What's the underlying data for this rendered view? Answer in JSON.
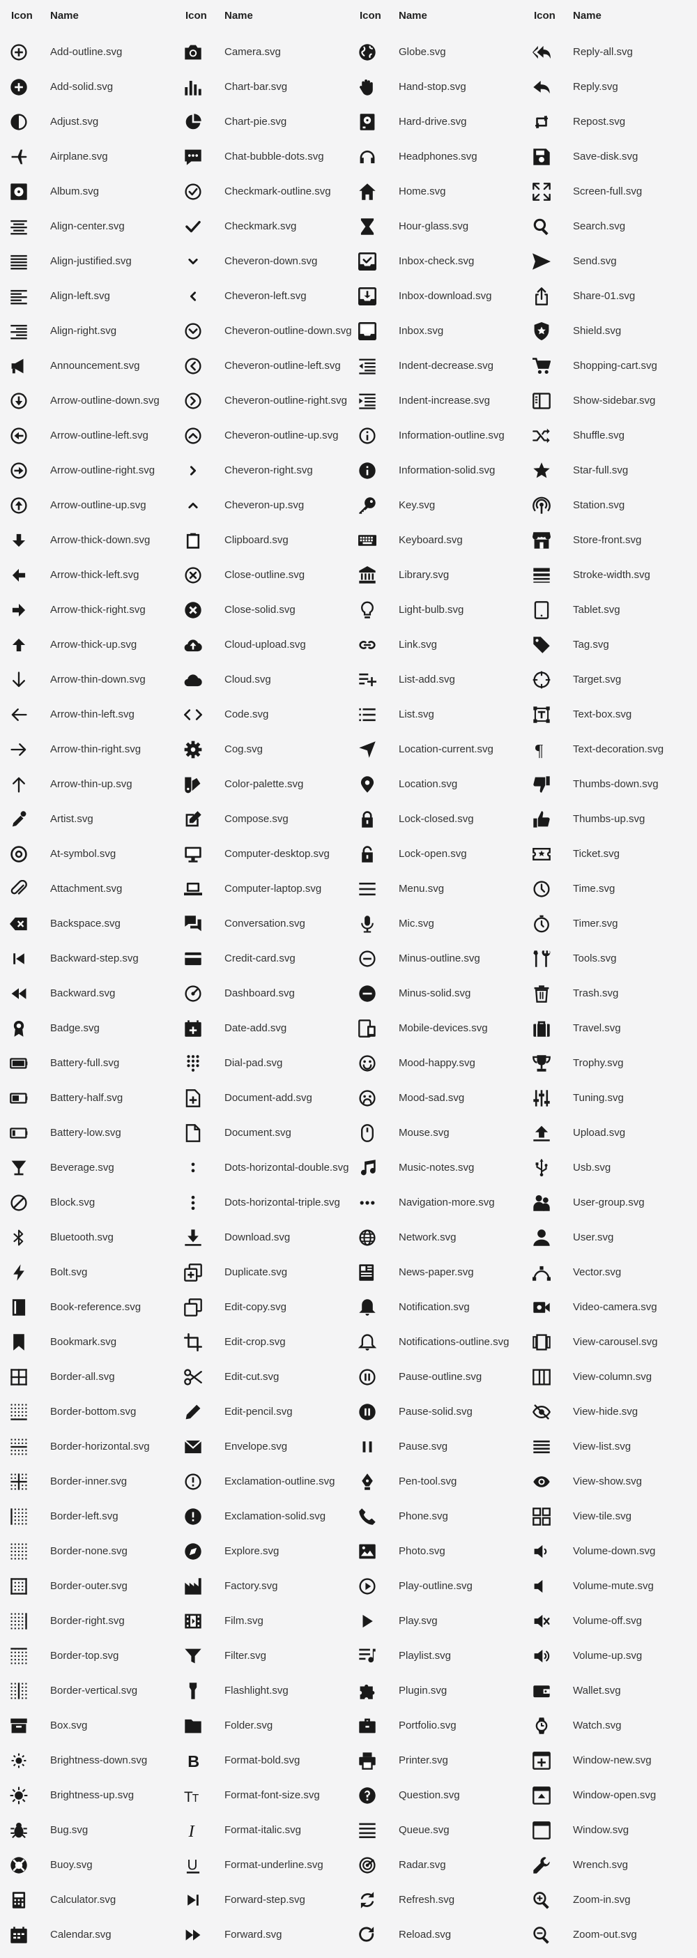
{
  "headers": {
    "icon": "Icon",
    "name": "Name"
  },
  "columns": [
    [
      "Add-outline.svg",
      "Add-solid.svg",
      "Adjust.svg",
      "Airplane.svg",
      "Album.svg",
      "Align-center.svg",
      "Align-justified.svg",
      "Align-left.svg",
      "Align-right.svg",
      "Announcement.svg",
      "Arrow-outline-down.svg",
      "Arrow-outline-left.svg",
      "Arrow-outline-right.svg",
      "Arrow-outline-up.svg",
      "Arrow-thick-down.svg",
      "Arrow-thick-left.svg",
      "Arrow-thick-right.svg",
      "Arrow-thick-up.svg",
      "Arrow-thin-down.svg",
      "Arrow-thin-left.svg",
      "Arrow-thin-right.svg",
      "Arrow-thin-up.svg",
      "Artist.svg",
      "At-symbol.svg",
      "Attachment.svg",
      "Backspace.svg",
      "Backward-step.svg",
      "Backward.svg",
      "Badge.svg",
      "Battery-full.svg",
      "Battery-half.svg",
      "Battery-low.svg",
      "Beverage.svg",
      "Block.svg",
      "Bluetooth.svg",
      "Bolt.svg",
      "Book-reference.svg",
      "Bookmark.svg",
      "Border-all.svg",
      "Border-bottom.svg",
      "Border-horizontal.svg",
      "Border-inner.svg",
      "Border-left.svg",
      "Border-none.svg",
      "Border-outer.svg",
      "Border-right.svg",
      "Border-top.svg",
      "Border-vertical.svg",
      "Box.svg",
      "Brightness-down.svg",
      "Brightness-up.svg",
      "Bug.svg",
      "Buoy.svg",
      "Calculator.svg",
      "Calendar.svg"
    ],
    [
      "Camera.svg",
      "Chart-bar.svg",
      "Chart-pie.svg",
      "Chat-bubble-dots.svg",
      "Checkmark-outline.svg",
      "Checkmark.svg",
      "Cheveron-down.svg",
      "Cheveron-left.svg",
      "Cheveron-outline-down.svg",
      "Cheveron-outline-left.svg",
      "Cheveron-outline-right.svg",
      "Cheveron-outline-up.svg",
      "Cheveron-right.svg",
      "Cheveron-up.svg",
      "Clipboard.svg",
      "Close-outline.svg",
      "Close-solid.svg",
      "Cloud-upload.svg",
      "Cloud.svg",
      "Code.svg",
      "Cog.svg",
      "Color-palette.svg",
      "Compose.svg",
      "Computer-desktop.svg",
      "Computer-laptop.svg",
      "Conversation.svg",
      "Credit-card.svg",
      "Dashboard.svg",
      "Date-add.svg",
      "Dial-pad.svg",
      "Document-add.svg",
      "Document.svg",
      "Dots-horizontal-double.svg",
      "Dots-horizontal-triple.svg",
      "Download.svg",
      "Duplicate.svg",
      "Edit-copy.svg",
      "Edit-crop.svg",
      "Edit-cut.svg",
      "Edit-pencil.svg",
      "Envelope.svg",
      "Exclamation-outline.svg",
      "Exclamation-solid.svg",
      "Explore.svg",
      "Factory.svg",
      "Film.svg",
      "Filter.svg",
      "Flashlight.svg",
      "Folder.svg",
      "Format-bold.svg",
      "Format-font-size.svg",
      "Format-italic.svg",
      "Format-underline.svg",
      "Forward-step.svg",
      "Forward.svg"
    ],
    [
      "Globe.svg",
      "Hand-stop.svg",
      "Hard-drive.svg",
      "Headphones.svg",
      "Home.svg",
      "Hour-glass.svg",
      "Inbox-check.svg",
      "Inbox-download.svg",
      "Inbox.svg",
      "Indent-decrease.svg",
      "Indent-increase.svg",
      "Information-outline.svg",
      "Information-solid.svg",
      "Key.svg",
      "Keyboard.svg",
      "Library.svg",
      "Light-bulb.svg",
      "Link.svg",
      "List-add.svg",
      "List.svg",
      "Location-current.svg",
      "Location.svg",
      "Lock-closed.svg",
      "Lock-open.svg",
      "Menu.svg",
      "Mic.svg",
      "Minus-outline.svg",
      "Minus-solid.svg",
      "Mobile-devices.svg",
      "Mood-happy.svg",
      "Mood-sad.svg",
      "Mouse.svg",
      "Music-notes.svg",
      "Navigation-more.svg",
      "Network.svg",
      "News-paper.svg",
      "Notification.svg",
      "Notifications-outline.svg",
      "Pause-outline.svg",
      "Pause-solid.svg",
      "Pause.svg",
      "Pen-tool.svg",
      "Phone.svg",
      "Photo.svg",
      "Play-outline.svg",
      "Play.svg",
      "Playlist.svg",
      "Plugin.svg",
      "Portfolio.svg",
      "Printer.svg",
      "Question.svg",
      "Queue.svg",
      "Radar.svg",
      "Refresh.svg",
      "Reload.svg"
    ],
    [
      "Reply-all.svg",
      "Reply.svg",
      "Repost.svg",
      "Save-disk.svg",
      "Screen-full.svg",
      "Search.svg",
      "Send.svg",
      "Share-01.svg",
      "Shield.svg",
      "Shopping-cart.svg",
      "Show-sidebar.svg",
      "Shuffle.svg",
      "Star-full.svg",
      "Station.svg",
      "Store-front.svg",
      "Stroke-width.svg",
      "Tablet.svg",
      "Tag.svg",
      "Target.svg",
      "Text-box.svg",
      "Text-decoration.svg",
      "Thumbs-down.svg",
      "Thumbs-up.svg",
      "Ticket.svg",
      "Time.svg",
      "Timer.svg",
      "Tools.svg",
      "Trash.svg",
      "Travel.svg",
      "Trophy.svg",
      "Tuning.svg",
      "Upload.svg",
      "Usb.svg",
      "User-group.svg",
      "User.svg",
      "Vector.svg",
      "Video-camera.svg",
      "View-carousel.svg",
      "View-column.svg",
      "View-hide.svg",
      "View-list.svg",
      "View-show.svg",
      "View-tile.svg",
      "Volume-down.svg",
      "Volume-mute.svg",
      "Volume-off.svg",
      "Volume-up.svg",
      "Wallet.svg",
      "Watch.svg",
      "Window-new.svg",
      "Window-open.svg",
      "Window.svg",
      "Wrench.svg",
      "Zoom-in.svg",
      "Zoom-out.svg"
    ]
  ]
}
